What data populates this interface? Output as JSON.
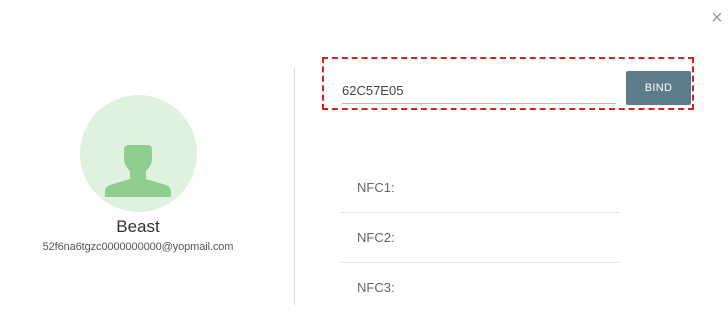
{
  "dialog": {
    "close_label": "×"
  },
  "profile": {
    "name": "Beast",
    "email": "52f6na6tgzc0000000000@yopmail.com",
    "avatar_icon": "user-silhouette-icon"
  },
  "bind_form": {
    "card_value": "62C57E05",
    "bind_label": "BIND"
  },
  "nfc_slots": [
    {
      "label": "NFC1:"
    },
    {
      "label": "NFC2:"
    },
    {
      "label": "NFC3:"
    }
  ],
  "colors": {
    "bind_button": "#5d7b8a",
    "highlight": "#d9201a",
    "avatar_bg": "#dff2df",
    "avatar_icon": "#8fce8f"
  }
}
